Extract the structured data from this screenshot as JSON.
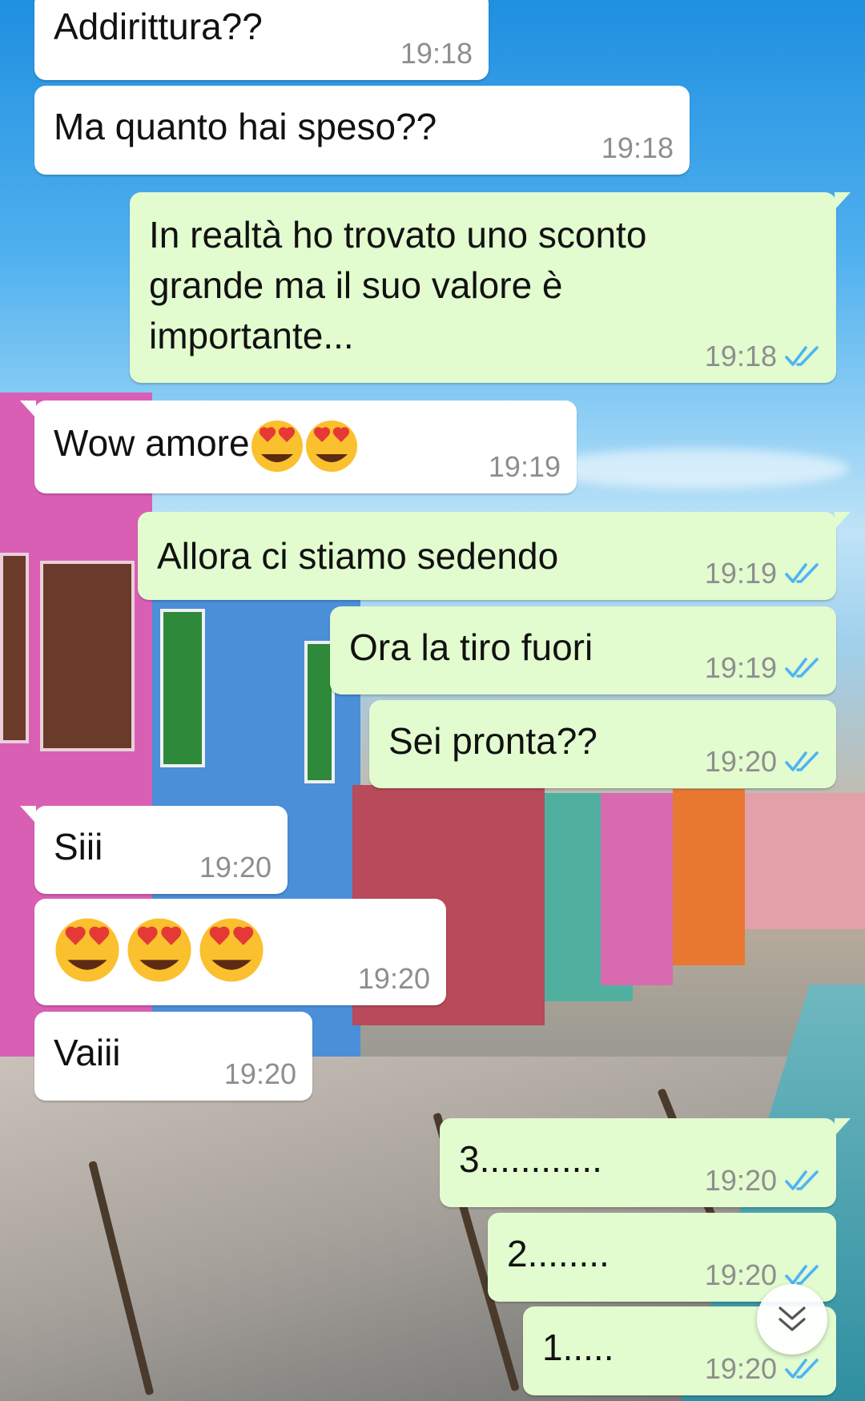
{
  "messages": [
    {
      "dir": "in",
      "text": "Addirittura??",
      "time": "19:18"
    },
    {
      "dir": "in",
      "text": "Ma quanto hai speso??",
      "time": "19:18"
    },
    {
      "dir": "out",
      "text": "In realtà ho trovato uno sconto\ngrande ma il suo valore è\nimportante...",
      "time": "19:18",
      "status": "read"
    },
    {
      "dir": "in",
      "text": "Wow amore",
      "emojis": [
        "heart-eyes",
        "heart-eyes"
      ],
      "time": "19:19"
    },
    {
      "dir": "out",
      "text": "Allora ci stiamo sedendo",
      "time": "19:19",
      "status": "read"
    },
    {
      "dir": "out",
      "text": "Ora la tiro fuori",
      "time": "19:19",
      "status": "read"
    },
    {
      "dir": "out",
      "text": "Sei pronta??",
      "time": "19:20",
      "status": "read"
    },
    {
      "dir": "in",
      "text": "Siii",
      "time": "19:20"
    },
    {
      "dir": "in",
      "text": "",
      "emojis": [
        "heart-eyes",
        "heart-eyes",
        "heart-eyes"
      ],
      "time": "19:20"
    },
    {
      "dir": "in",
      "text": "Vaiii",
      "time": "19:20"
    },
    {
      "dir": "out",
      "text": "3............",
      "time": "19:20",
      "status": "read"
    },
    {
      "dir": "out",
      "text": "2........",
      "time": "19:20",
      "status": "read"
    },
    {
      "dir": "out",
      "text": "1.....",
      "time": "19:20",
      "status": "read"
    }
  ],
  "colors": {
    "incoming_bubble": "#ffffff",
    "outgoing_bubble": "#e2fbcf",
    "read_ticks": "#4fb3f6",
    "timestamp": "#8e8e8e"
  },
  "icons": {
    "read_receipt": "double-check-icon",
    "emoji": "heart-eyes-emoji",
    "scroll": "scroll-to-bottom-icon"
  }
}
